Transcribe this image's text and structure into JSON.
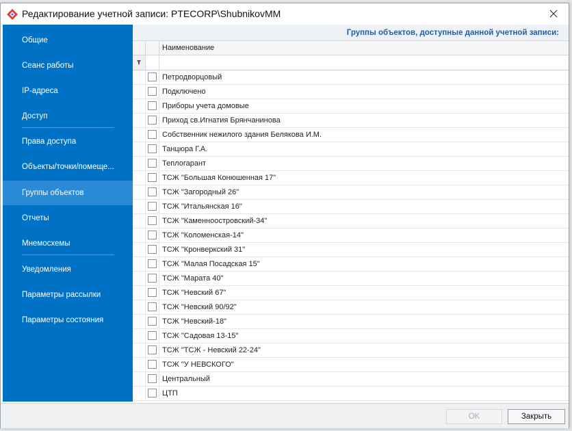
{
  "window": {
    "title": "Редактирование учетной записи: PTECORP\\ShubnikovMM"
  },
  "sidebar": {
    "items": [
      {
        "label": "Общие"
      },
      {
        "label": "Сеанс работы"
      },
      {
        "label": "IP-адреса"
      },
      {
        "label": "Доступ"
      },
      {
        "label": "Права доступа"
      },
      {
        "label": "Объекты/точки/помеще..."
      },
      {
        "label": "Группы объектов",
        "selected": true
      },
      {
        "label": "Отчеты"
      },
      {
        "label": "Мнемосхемы"
      },
      {
        "label": "Уведомления"
      },
      {
        "label": "Параметры рассылки"
      },
      {
        "label": "Параметры состояния"
      }
    ]
  },
  "main": {
    "header": "Группы объектов, доступные данной учетной записи:",
    "grid": {
      "column_name": "Наименование",
      "filter_icon": "filter-pin-icon",
      "rows": [
        "Петродворцовый",
        "Подключено",
        "Приборы учета домовые",
        "Приход св.Игнатия Брянчанинова",
        "Собственник нежилого здания Белякова И.М.",
        "Танцюра Г.А.",
        "Теплогарант",
        "ТСЖ \"Большая Конюшенная 17\"",
        "ТСЖ \"Загородный 26\"",
        "ТСЖ \"Итальянская 16\"",
        "ТСЖ \"Каменноостровский-34\"",
        "ТСЖ \"Коломенская-14\"",
        "ТСЖ \"Кронверкский 31\"",
        "ТСЖ \"Малая Посадская 15\"",
        "ТСЖ \"Марата 40\"",
        "ТСЖ \"Невский 67\"",
        "ТСЖ \"Невский 90/92\"",
        "ТСЖ \"Невский-18\"",
        "ТСЖ \"Садовая 13-15\"",
        "ТСЖ \"ТСЖ - Невский 22-24\"",
        "ТСЖ \"У НЕВСКОГО\"",
        "Центральный",
        "ЦТП"
      ]
    }
  },
  "footer": {
    "ok_label": "OK",
    "close_label": "Закрыть"
  },
  "colors": {
    "sidebar": "#0072c6",
    "sidebar_selected": "#2b8ad6",
    "header_text": "#1f5fa8"
  }
}
